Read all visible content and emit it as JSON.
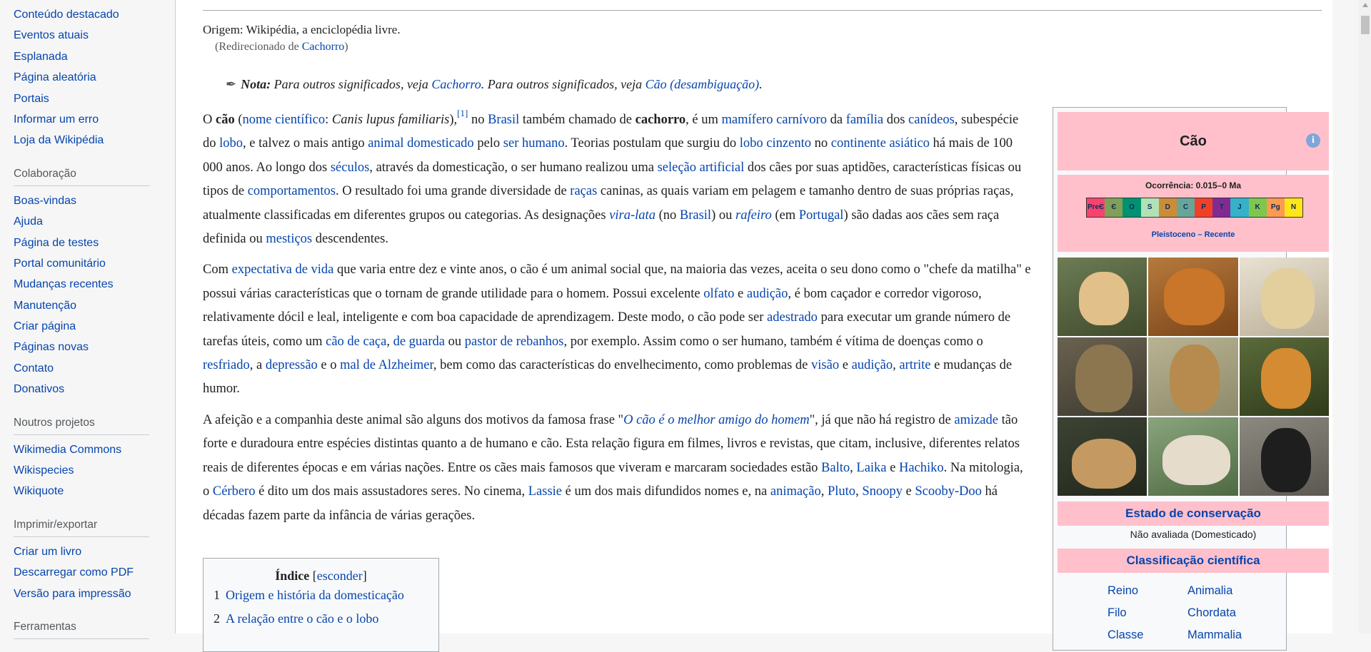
{
  "sidebar": {
    "nav_items": [
      "Conteúdo destacado",
      "Eventos atuais",
      "Esplanada",
      "Página aleatória",
      "Portais",
      "Informar um erro",
      "Loja da Wikipédia"
    ],
    "collab_head": "Colaboração",
    "collab_items": [
      "Boas-vindas",
      "Ajuda",
      "Página de testes",
      "Portal comunitário",
      "Mudanças recentes",
      "Manutenção",
      "Criar página",
      "Páginas novas",
      "Contato",
      "Donativos"
    ],
    "projects_head": "Noutros projetos",
    "projects_items": [
      "Wikimedia Commons",
      "Wikispecies",
      "Wikiquote"
    ],
    "print_head": "Imprimir/exportar",
    "print_items": [
      "Criar um livro",
      "Descarregar como PDF",
      "Versão para impressão"
    ],
    "tools_head": "Ferramentas"
  },
  "article": {
    "site_sub": "Origem: Wikipédia, a enciclopédia livre.",
    "redirect_prefix": "(Redirecionado de ",
    "redirect_link": "Cachorro",
    "redirect_suffix": ")",
    "hatnote_label": "Nota:",
    "hatnote_text1": " Para outros significados, veja ",
    "hatnote_link1": "Cachorro",
    "hatnote_text2": ". Para outros significados, veja ",
    "hatnote_link2": "Cão (desambiguação)",
    "hatnote_end": "."
  },
  "toc": {
    "title": "Índice",
    "toggle": "esconder",
    "items": [
      {
        "num": "1",
        "label": "Origem e história da domesticação"
      },
      {
        "num": "2",
        "label": "A relação entre o cão e o lobo"
      }
    ]
  },
  "infobox": {
    "title": "Cão",
    "info_icon": "i",
    "occurrence": "Ocorrência: 0.015–0 Ma",
    "timeline": [
      "PreЄ",
      "Є",
      "O",
      "S",
      "D",
      "C",
      "P",
      "T",
      "J",
      "K",
      "Pg",
      "N"
    ],
    "timeline_colors": [
      "#f74370",
      "#7fa056",
      "#009270",
      "#b3e1b6",
      "#cb8c37",
      "#67a599",
      "#f04028",
      "#812b92",
      "#34b2c9",
      "#7fc64e",
      "#fd9a52",
      "#ffe619"
    ],
    "range": "Pleistoceno – Recente",
    "conservation_head": "Estado de conservação",
    "conservation_status": "Não avaliada (Domesticado)",
    "classification_head": "Classificação científica",
    "taxonomy": [
      {
        "rank": "Reino",
        "value": "Animalia"
      },
      {
        "rank": "Filo",
        "value": "Chordata"
      },
      {
        "rank": "Classe",
        "value": "Mammalia"
      }
    ]
  }
}
